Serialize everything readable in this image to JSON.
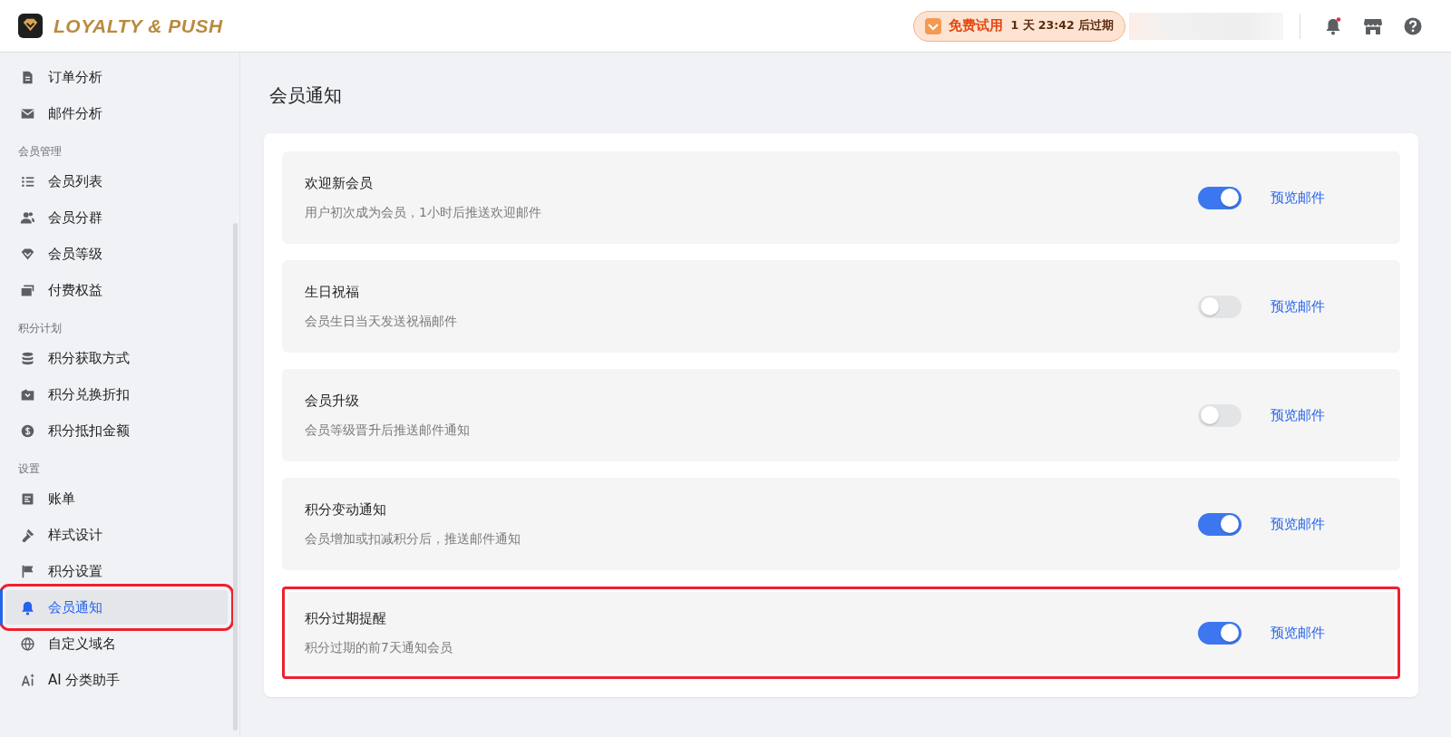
{
  "header": {
    "logo_text": "LOYALTY & PUSH",
    "trial": {
      "label": "免费试用",
      "remaining": "1 天 23:42 后过期"
    },
    "notification_dot": true
  },
  "sidebar": {
    "sections": [
      {
        "items": [
          {
            "label": "订单分析",
            "kind": "doc",
            "selected": false,
            "highlighted": false
          },
          {
            "label": "邮件分析",
            "kind": "mail",
            "selected": false,
            "highlighted": false
          }
        ]
      },
      {
        "title": "会员管理",
        "items": [
          {
            "label": "会员列表",
            "kind": "list",
            "selected": false,
            "highlighted": false
          },
          {
            "label": "会员分群",
            "kind": "users",
            "selected": false,
            "highlighted": false
          },
          {
            "label": "会员等级",
            "kind": "gem",
            "selected": false,
            "highlighted": false
          },
          {
            "label": "付费权益",
            "kind": "card",
            "selected": false,
            "highlighted": false
          }
        ]
      },
      {
        "title": "积分计划",
        "items": [
          {
            "label": "积分获取方式",
            "kind": "db",
            "selected": false,
            "highlighted": false
          },
          {
            "label": "积分兑换折扣",
            "kind": "box",
            "selected": false,
            "highlighted": false
          },
          {
            "label": "积分抵扣金额",
            "kind": "dollar",
            "selected": false,
            "highlighted": false
          }
        ]
      },
      {
        "title": "设置",
        "items": [
          {
            "label": "账单",
            "kind": "bill",
            "selected": false,
            "highlighted": false
          },
          {
            "label": "样式设计",
            "kind": "brush",
            "selected": false,
            "highlighted": false
          },
          {
            "label": "积分设置",
            "kind": "flag",
            "selected": false,
            "highlighted": false
          },
          {
            "label": "会员通知",
            "kind": "bell",
            "selected": true,
            "highlighted": true
          },
          {
            "label": "自定义域名",
            "kind": "globe",
            "selected": false,
            "highlighted": false
          },
          {
            "label": "AI 分类助手",
            "kind": "ai",
            "selected": false,
            "highlighted": false
          }
        ]
      }
    ]
  },
  "page": {
    "title": "会员通知",
    "notifications": [
      {
        "title": "欢迎新会员",
        "description": "用户初次成为会员，1小时后推送欢迎邮件",
        "on": true,
        "action": "预览邮件",
        "highlighted": false
      },
      {
        "title": "生日祝福",
        "description": "会员生日当天发送祝福邮件",
        "on": false,
        "action": "预览邮件",
        "highlighted": false
      },
      {
        "title": "会员升级",
        "description": "会员等级晋升后推送邮件通知",
        "on": false,
        "action": "预览邮件",
        "highlighted": false
      },
      {
        "title": "积分变动通知",
        "description": "会员增加或扣减积分后，推送邮件通知",
        "on": true,
        "action": "预览邮件",
        "highlighted": false
      },
      {
        "title": "积分过期提醒",
        "description": "积分过期的前7天通知会员",
        "on": true,
        "action": "预览邮件",
        "highlighted": true
      }
    ]
  }
}
